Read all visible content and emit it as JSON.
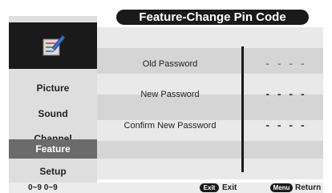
{
  "header": {
    "title": "Feature-Change Pin Code"
  },
  "sidebar": {
    "logo_icon": "pencil-checklist-icon",
    "items": [
      {
        "label": "Picture",
        "active": false
      },
      {
        "label": "Sound",
        "active": false
      },
      {
        "label": "Channel",
        "active": false
      },
      {
        "label": "Feature",
        "active": true
      },
      {
        "label": "Setup",
        "active": false
      }
    ]
  },
  "form": {
    "old_password_label": "Old Password",
    "old_password_value": "- - - -",
    "new_password_label": "New Password",
    "new_password_value": "- - - -",
    "confirm_password_label": "Confirm New Password",
    "confirm_password_value": "- - - -"
  },
  "footer": {
    "digits_hint": "0~9 0~9",
    "exit_key": "Exit",
    "exit_label": "Exit",
    "menu_key": "Menu",
    "menu_label": "Return"
  },
  "colors": {
    "accent_dark": "#1a1a1a",
    "active_item": "#6b6b6b",
    "panel": "#d5d5d5"
  }
}
